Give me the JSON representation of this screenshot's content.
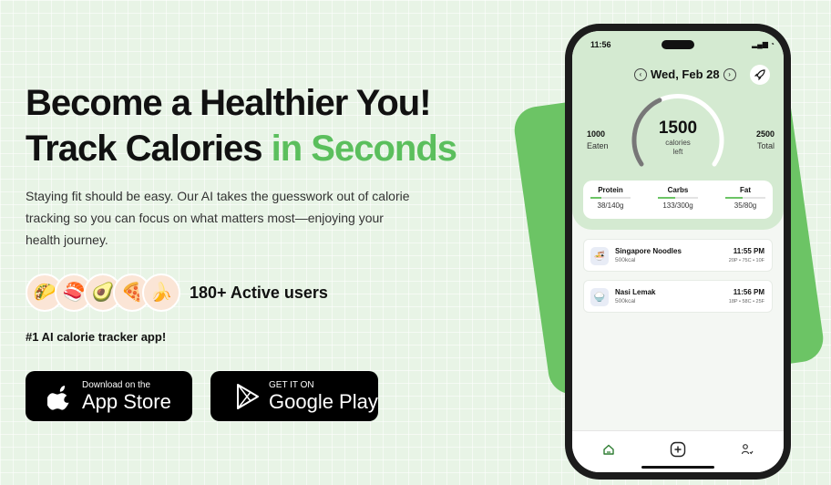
{
  "hero": {
    "title_line1": "Become a Healthier You!",
    "title_line2_black": "Track Calories",
    "title_line2_green": "in Seconds",
    "description": "Staying fit should be easy. Our AI takes the guesswork out of calorie tracking so you can focus on what matters most—enjoying your health journey.",
    "users_label": "180+ Active users",
    "tagline": "#1 AI calorie tracker app!",
    "avatars": [
      "taco",
      "sushi",
      "avocado",
      "pizza",
      "banana"
    ]
  },
  "buttons": {
    "appstore_small": "Download on the",
    "appstore_big": "App Store",
    "googleplay_small": "GET IT ON",
    "googleplay_big": "Google Play"
  },
  "colors": {
    "accent": "#5bbf5d",
    "card_green": "#6cc465",
    "screen_top": "#d4ead1"
  },
  "phone": {
    "status_time": "11:56",
    "date": "Wed, Feb 28",
    "calories_left": "1500",
    "calories_label": "calories",
    "left_label": "left",
    "eaten_value": "1000",
    "eaten_label": "Eaten",
    "total_value": "2500",
    "total_label": "Total",
    "calories_progress": 0.4,
    "macros": [
      {
        "name": "Protein",
        "value": "38/140g",
        "progress": 0.27
      },
      {
        "name": "Carbs",
        "value": "133/300g",
        "progress": 0.44
      },
      {
        "name": "Fat",
        "value": "35/80g",
        "progress": 0.44
      }
    ],
    "meals": [
      {
        "name": "Singapore Noodles",
        "kcal": "500kcal",
        "time": "11:55 PM",
        "macros": "20P • 75C • 10F"
      },
      {
        "name": "Nasi Lemak",
        "kcal": "500kcal",
        "time": "11:56 PM",
        "macros": "18P • 58C • 25F"
      }
    ],
    "tabs": [
      "home-icon",
      "add-icon",
      "profile-icon"
    ]
  }
}
